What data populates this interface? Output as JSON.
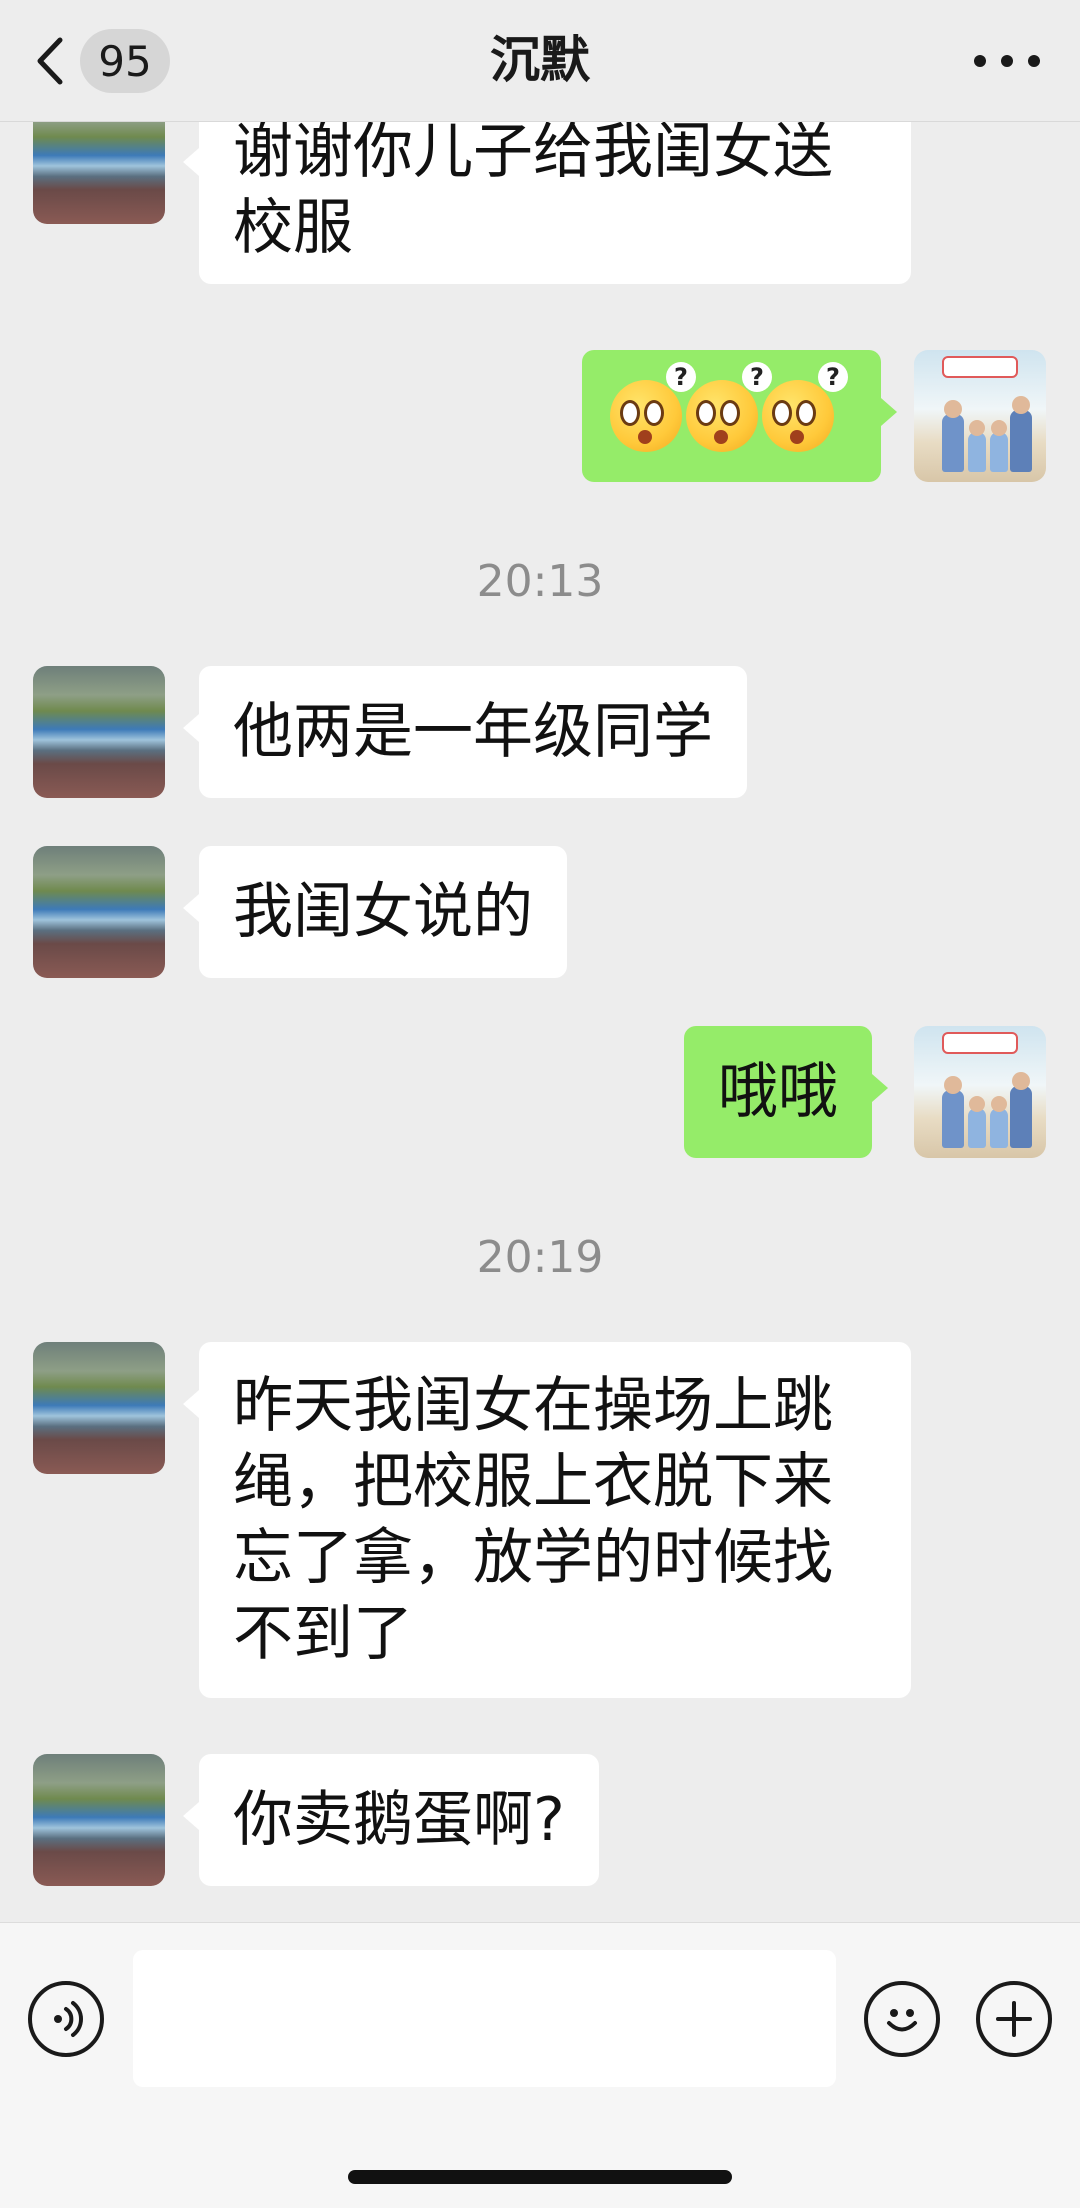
{
  "header": {
    "back_icon": "chevron-left-icon",
    "unread_count": "95",
    "title": "沉默",
    "more_icon": "more-horizontal-icon"
  },
  "messages": [
    {
      "side": "left",
      "type": "text",
      "text": "谢谢你儿子给我闺女送\n校服"
    },
    {
      "side": "right",
      "type": "emoji",
      "emoji": [
        "confused-face-question-icon",
        "confused-face-question-icon",
        "confused-face-question-icon"
      ]
    },
    {
      "type": "time",
      "text": "20:13"
    },
    {
      "side": "left",
      "type": "text",
      "text": "他两是一年级同学"
    },
    {
      "side": "left",
      "type": "text",
      "text": "我闺女说的"
    },
    {
      "side": "right",
      "type": "text",
      "text": "哦哦"
    },
    {
      "type": "time",
      "text": "20:19"
    },
    {
      "side": "left",
      "type": "text",
      "text": "昨天我闺女在操场上跳\n绳，把校服上衣脱下来\n忘了拿，放学的时候找\n不到了"
    },
    {
      "side": "left",
      "type": "text",
      "text": "你卖鹅蛋啊?"
    }
  ],
  "input_bar": {
    "voice_icon": "voice-input-icon",
    "text_value": "",
    "emoji_icon": "emoji-face-icon",
    "plus_icon": "plus-circle-icon"
  },
  "colors": {
    "background": "#ededed",
    "bubble_self": "#95ec69",
    "bubble_other": "#ffffff",
    "timestamp": "#8c8c8c"
  }
}
